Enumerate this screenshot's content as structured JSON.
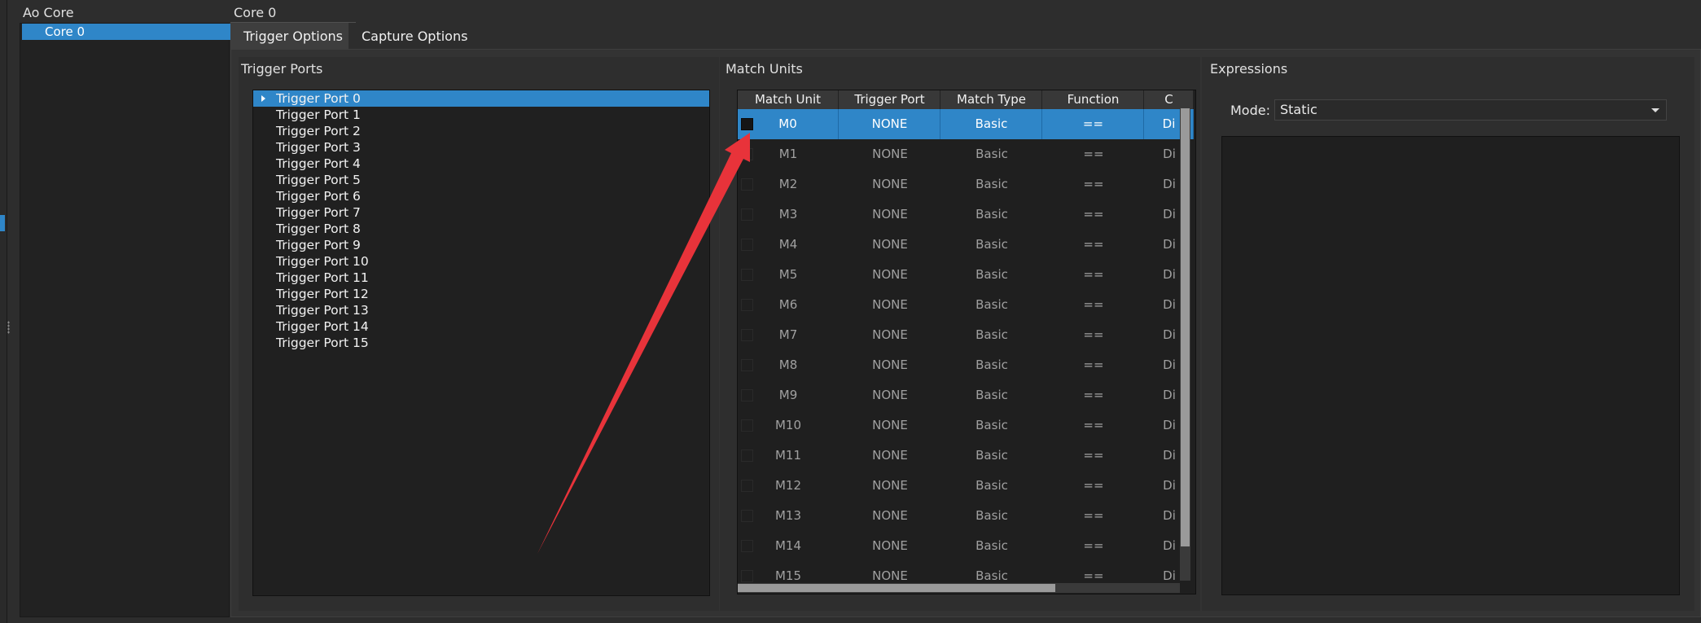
{
  "tree": {
    "header": "Ao Core",
    "selected_item": "Core 0"
  },
  "core_title": "Core 0",
  "tabs": [
    {
      "label": "Trigger Options"
    },
    {
      "label": "Capture Options"
    }
  ],
  "trigger_ports": {
    "title": "Trigger Ports",
    "items": [
      "Trigger Port 0",
      "Trigger Port 1",
      "Trigger Port 2",
      "Trigger Port 3",
      "Trigger Port 4",
      "Trigger Port 5",
      "Trigger Port 6",
      "Trigger Port 7",
      "Trigger Port 8",
      "Trigger Port 9",
      "Trigger Port 10",
      "Trigger Port 11",
      "Trigger Port 12",
      "Trigger Port 13",
      "Trigger Port 14",
      "Trigger Port 15"
    ],
    "selected_index": 0
  },
  "match_units": {
    "title": "Match Units",
    "columns": [
      "Match Unit",
      "Trigger Port",
      "Match Type",
      "Function",
      "C"
    ],
    "rows": [
      [
        "M0",
        "NONE",
        "Basic",
        "==",
        "Di"
      ],
      [
        "M1",
        "NONE",
        "Basic",
        "==",
        "Di"
      ],
      [
        "M2",
        "NONE",
        "Basic",
        "==",
        "Di"
      ],
      [
        "M3",
        "NONE",
        "Basic",
        "==",
        "Di"
      ],
      [
        "M4",
        "NONE",
        "Basic",
        "==",
        "Di"
      ],
      [
        "M5",
        "NONE",
        "Basic",
        "==",
        "Di"
      ],
      [
        "M6",
        "NONE",
        "Basic",
        "==",
        "Di"
      ],
      [
        "M7",
        "NONE",
        "Basic",
        "==",
        "Di"
      ],
      [
        "M8",
        "NONE",
        "Basic",
        "==",
        "Di"
      ],
      [
        "M9",
        "NONE",
        "Basic",
        "==",
        "Di"
      ],
      [
        "M10",
        "NONE",
        "Basic",
        "==",
        "Di"
      ],
      [
        "M11",
        "NONE",
        "Basic",
        "==",
        "Di"
      ],
      [
        "M12",
        "NONE",
        "Basic",
        "==",
        "Di"
      ],
      [
        "M13",
        "NONE",
        "Basic",
        "==",
        "Di"
      ],
      [
        "M14",
        "NONE",
        "Basic",
        "==",
        "Di"
      ],
      [
        "M15",
        "NONE",
        "Basic",
        "==",
        "Di"
      ]
    ],
    "selected_index": 0
  },
  "expressions": {
    "title": "Expressions",
    "mode_label": "Mode:",
    "mode_value": "Static"
  },
  "colors": {
    "selection": "#2f86c8",
    "annotation_arrow": "#e8333a"
  }
}
